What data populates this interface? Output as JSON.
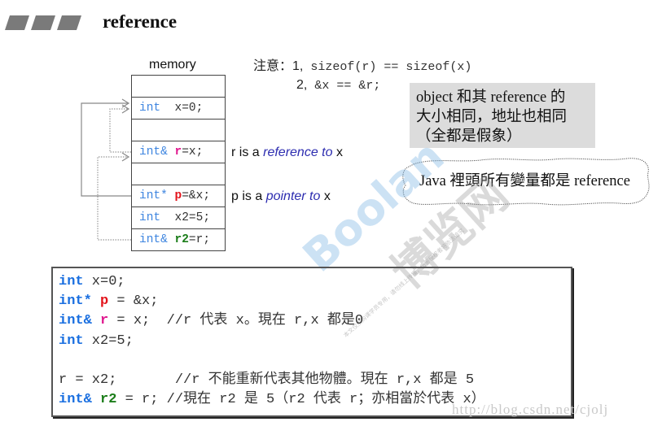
{
  "header": {
    "bullet_icon": "parallelogram-bars-icon",
    "title": "reference"
  },
  "memory": {
    "label": "memory",
    "rows": [
      {
        "type": "",
        "var": "",
        "rest": ""
      },
      {
        "type": "int  ",
        "var": "",
        "rest": "x=0;"
      },
      {
        "type": "",
        "var": "",
        "rest": ""
      },
      {
        "type": "int& ",
        "var": "r",
        "rest": "=x;"
      },
      {
        "type": "",
        "var": "",
        "rest": ""
      },
      {
        "type": "int* ",
        "var": "p",
        "rest": "=&x;"
      },
      {
        "type": "int  ",
        "var": "",
        "rest": "x2=5;"
      },
      {
        "type": "int& ",
        "var": "r2",
        "rest": "=r;"
      }
    ],
    "notes": {
      "r_prefix": "r is a ",
      "r_italic": "reference to",
      "r_suffix": " x",
      "p_prefix": "p is a ",
      "p_italic": "pointer to",
      "p_suffix": " x"
    }
  },
  "attention": {
    "label": "注意：",
    "item1_num": "1,",
    "item1_code": " sizeof(r) == sizeof(x)",
    "item2_num": "2,",
    "item2_code": " &x == &r;"
  },
  "grey_note": {
    "line1": "object 和其 reference 的",
    "line2": "大小相同，地址也相同",
    "line3": "（全都是假象）"
  },
  "cloud_note": {
    "text": "Java 裡頭所有變量都是 reference"
  },
  "code": {
    "lines": [
      {
        "kw": "int",
        "var": "",
        "var_class": "",
        "rest": " x=0;"
      },
      {
        "kw": "int*",
        "var": " p",
        "var_class": "red",
        "rest": " = &x;"
      },
      {
        "kw": "int&",
        "var": " r",
        "var_class": "mag",
        "rest": " = x;  //r 代表 x。現在 r,x 都是0"
      },
      {
        "kw": "int",
        "var": "",
        "var_class": "",
        "rest": " x2=5;"
      },
      {
        "kw": "",
        "var": "",
        "var_class": "",
        "rest": ""
      },
      {
        "kw": "",
        "var": "",
        "var_class": "",
        "rest": "r = x2;       //r 不能重新代表其他物體。現在 r,x 都是 5"
      },
      {
        "kw": "int&",
        "var": " r2",
        "var_class": "green",
        "rest": " = r; //現在 r2 是 5（r2 代表 r；亦相當於代表 x）"
      }
    ]
  },
  "watermark": {
    "brand": "Boolan",
    "brand_cn": "博览网",
    "small": "本文仅供购课学员专用，请勿线上传播，伤害侵权者将依法追究"
  },
  "url_watermark": "http://blog.csdn.net/cjolj"
}
